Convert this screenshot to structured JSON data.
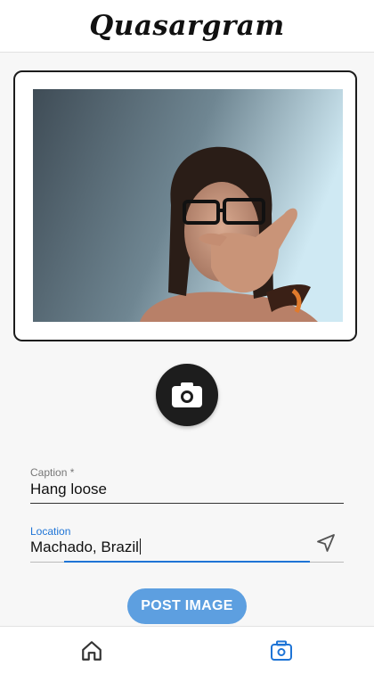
{
  "header": {
    "title": "Quasargram"
  },
  "photo": {
    "alt": "Captured selfie photo"
  },
  "camera_button": {
    "icon": "camera-icon"
  },
  "caption": {
    "label": "Caption *",
    "value": "Hang loose"
  },
  "location": {
    "label": "Location",
    "value": "Machado, Brazil",
    "icon": "navigation-arrow-icon"
  },
  "post_button": {
    "label": "POST IMAGE"
  },
  "bottom_nav": {
    "items": [
      {
        "icon": "home-icon",
        "active": false
      },
      {
        "icon": "camera-icon",
        "active": true
      }
    ]
  },
  "colors": {
    "accent": "#1e74d6",
    "post_button": "#5d9fe0",
    "dark": "#1d1d1d"
  }
}
